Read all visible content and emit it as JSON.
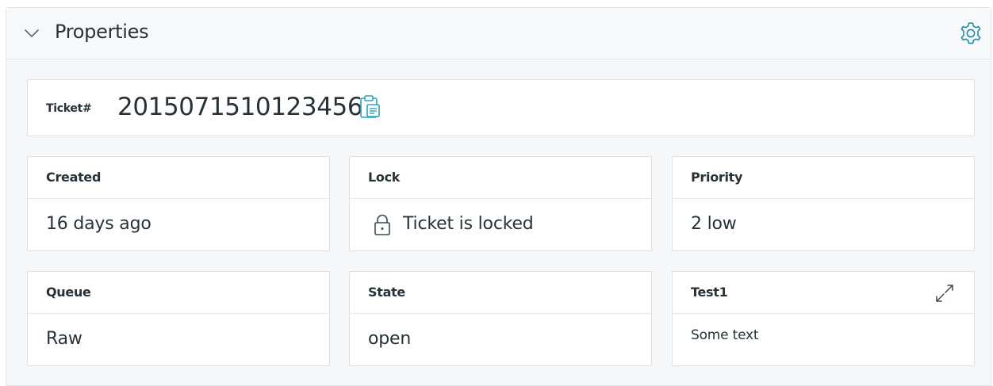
{
  "widget": {
    "title": "Properties",
    "icons": {
      "toggle": "chevron-down-icon",
      "settings": "gear-icon"
    }
  },
  "ticket": {
    "label": "Ticket#",
    "number": "2015071510123456",
    "copy_icon": "clipboard-icon"
  },
  "properties": {
    "created": {
      "label": "Created",
      "value": "16 days ago"
    },
    "lock": {
      "label": "Lock",
      "value": "Ticket is locked",
      "icon": "lock-icon"
    },
    "priority": {
      "label": "Priority",
      "value": "2 low"
    },
    "queue": {
      "label": "Queue",
      "value": "Raw"
    },
    "state": {
      "label": "State",
      "value": "open"
    },
    "test1": {
      "label": "Test1",
      "value": "Some text",
      "icon": "expand-icon"
    }
  },
  "colors": {
    "text": "#263238",
    "accent": "#1f8ea3",
    "border": "#dde1e4",
    "background": "#f6f7f8"
  }
}
